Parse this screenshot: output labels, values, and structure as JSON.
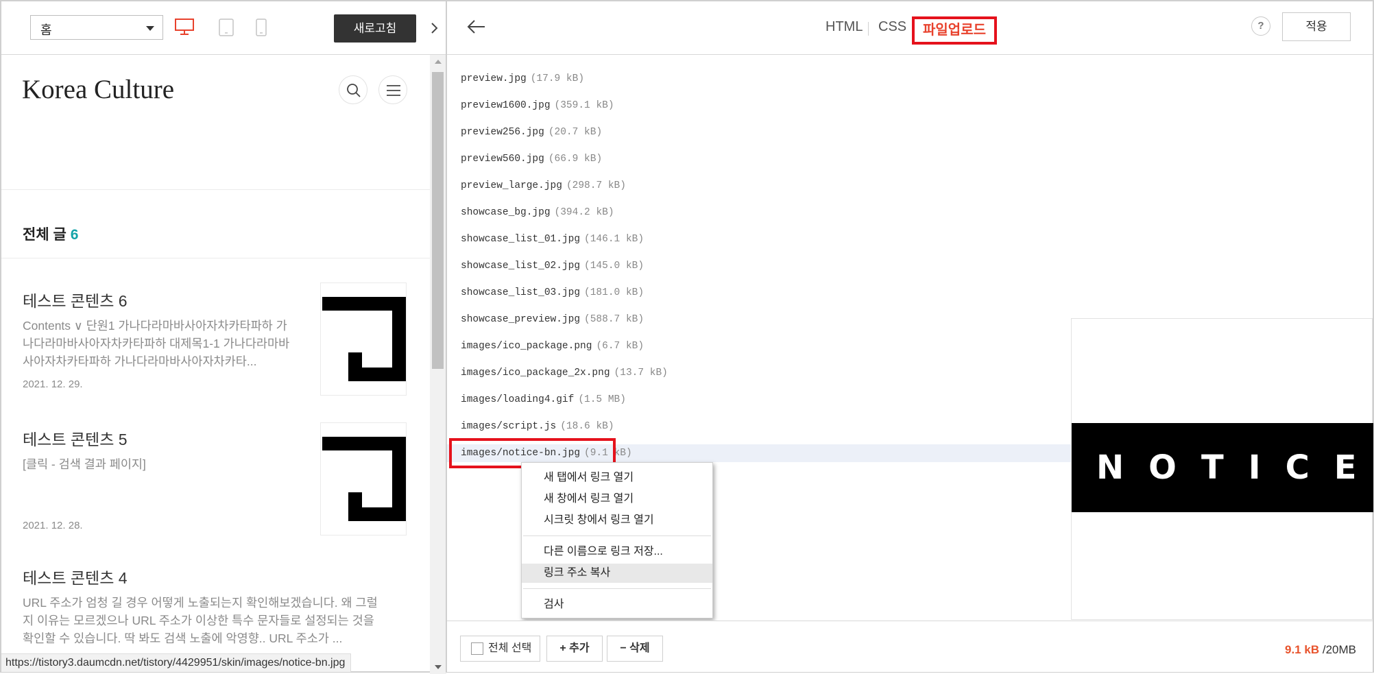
{
  "preview_toolbar": {
    "page_select_value": "홈",
    "refresh_label": "새로고침"
  },
  "blog": {
    "title": "Korea Culture",
    "section_title": "전체 글",
    "post_count": "6",
    "posts": [
      {
        "title": "테스트 콘텐츠 6",
        "excerpt": "Contents ∨ 단원1 가나다라마바사아자차카타파하 가나다라마바사아자차카타파하 대제목1-1 가나다라마바사아자차카타파하 가나다라마바사아자차카타...",
        "date": "2021. 12. 29."
      },
      {
        "title": "테스트 콘텐츠 5",
        "excerpt": "[클릭 - 검색 결과 페이지]",
        "date": "2021. 12. 28."
      },
      {
        "title": "테스트 콘텐츠 4",
        "excerpt": "URL 주소가 엄청 길 경우 어떻게 노출되는지 확인해보겠습니다. 왜 그럴지 이유는 모르겠으나 URL 주소가 이상한 특수 문자들로 설정되는 것을 확인할 수 있습니다. 딱 봐도 검색 노출에 악영향.. URL 주소가 ..."
      }
    ]
  },
  "status_bar": {
    "url": "https://tistory3.daumcdn.net/tistory/4429951/skin/images/notice-bn.jpg"
  },
  "editor_header": {
    "tabs": [
      {
        "label": "HTML"
      },
      {
        "label": "CSS"
      },
      {
        "label": "파일업로드"
      }
    ],
    "help_label": "?",
    "apply_label": "적용"
  },
  "files": [
    {
      "name": "preview.jpg",
      "size": "(17.9 kB)"
    },
    {
      "name": "preview1600.jpg",
      "size": "(359.1 kB)"
    },
    {
      "name": "preview256.jpg",
      "size": "(20.7 kB)"
    },
    {
      "name": "preview560.jpg",
      "size": "(66.9 kB)"
    },
    {
      "name": "preview_large.jpg",
      "size": "(298.7 kB)"
    },
    {
      "name": "showcase_bg.jpg",
      "size": "(394.2 kB)"
    },
    {
      "name": "showcase_list_01.jpg",
      "size": "(146.1 kB)"
    },
    {
      "name": "showcase_list_02.jpg",
      "size": "(145.0 kB)"
    },
    {
      "name": "showcase_list_03.jpg",
      "size": "(181.0 kB)"
    },
    {
      "name": "showcase_preview.jpg",
      "size": "(588.7 kB)"
    },
    {
      "name": "images/ico_package.png",
      "size": "(6.7 kB)"
    },
    {
      "name": "images/ico_package_2x.png",
      "size": "(13.7 kB)"
    },
    {
      "name": "images/loading4.gif",
      "size": "(1.5 MB)"
    },
    {
      "name": "images/script.js",
      "size": "(18.6 kB)"
    },
    {
      "name": "images/notice-bn.jpg",
      "size": "(9.1 kB)"
    }
  ],
  "preview_image": {
    "banner_text": "NOTICE"
  },
  "context_menu": {
    "items": [
      {
        "label": "새 탭에서 링크 열기"
      },
      {
        "label": "새 창에서 링크 열기"
      },
      {
        "label": "시크릿 창에서 링크 열기"
      },
      {
        "label": "다른 이름으로 링크 저장..."
      },
      {
        "label": "링크 주소 복사"
      },
      {
        "label": "검사"
      }
    ]
  },
  "footer": {
    "select_all_label": "전체 선택",
    "add_label": "+ 추가",
    "delete_label": "− 삭제",
    "used": "9.1 kB",
    "separator": "/",
    "limit": "20MB"
  },
  "colors": {
    "accent_red": "#e5121c",
    "count_teal": "#12a3a8",
    "usage_orange": "#e8532c"
  }
}
